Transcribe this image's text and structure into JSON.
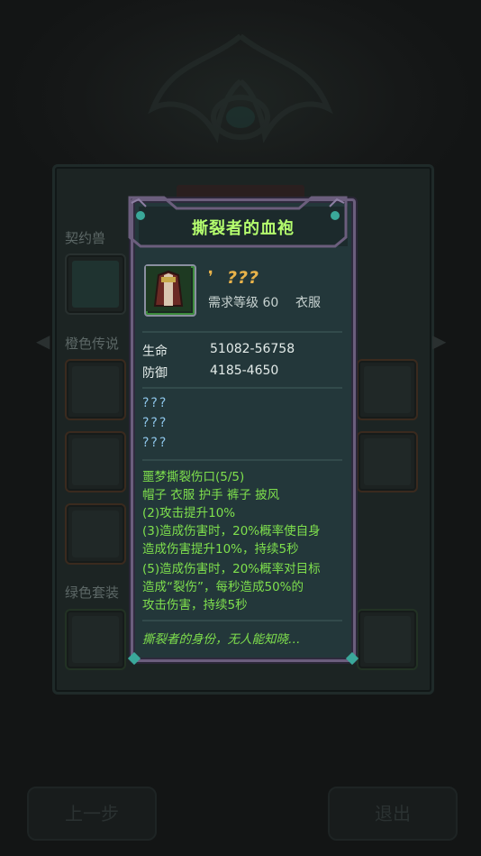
{
  "background": {
    "section_labels": [
      "契约兽",
      "橙色传说",
      "绿色套装"
    ],
    "buttons": {
      "prev": "上一步",
      "exit": "退出"
    }
  },
  "tooltip": {
    "title": "撕裂者的血袍",
    "quality_mark": "❜",
    "quality_name": "???",
    "required_level": "需求等级 60",
    "item_type": "衣服",
    "stats": [
      {
        "name": "生命",
        "value": "51082-56758"
      },
      {
        "name": "防御",
        "value": "4185-4650"
      }
    ],
    "unknown_attributes": [
      "???",
      "???",
      "???"
    ],
    "set_bonus": {
      "name": "噩梦撕裂伤口(5/5)",
      "pieces": "帽子 衣服 护手 裤子 披风",
      "effects": [
        "(2)攻击提升10%",
        "(3)造成伤害时，20%概率使自身",
        "造成伤害提升10%，持续5秒",
        "(5)造成伤害时，20%概率对目标",
        "造成“裂伤”，每秒造成50%的",
        "攻击伤害，持续5秒"
      ]
    },
    "flavor_text": "撕裂者的身份，无人能知晓…"
  },
  "colors": {
    "title": "#b5ff6e",
    "quality": "#e9b34a",
    "set_text": "#7fe04d",
    "unknown": "#8ec6ea",
    "frame": "#6b5e7d"
  }
}
